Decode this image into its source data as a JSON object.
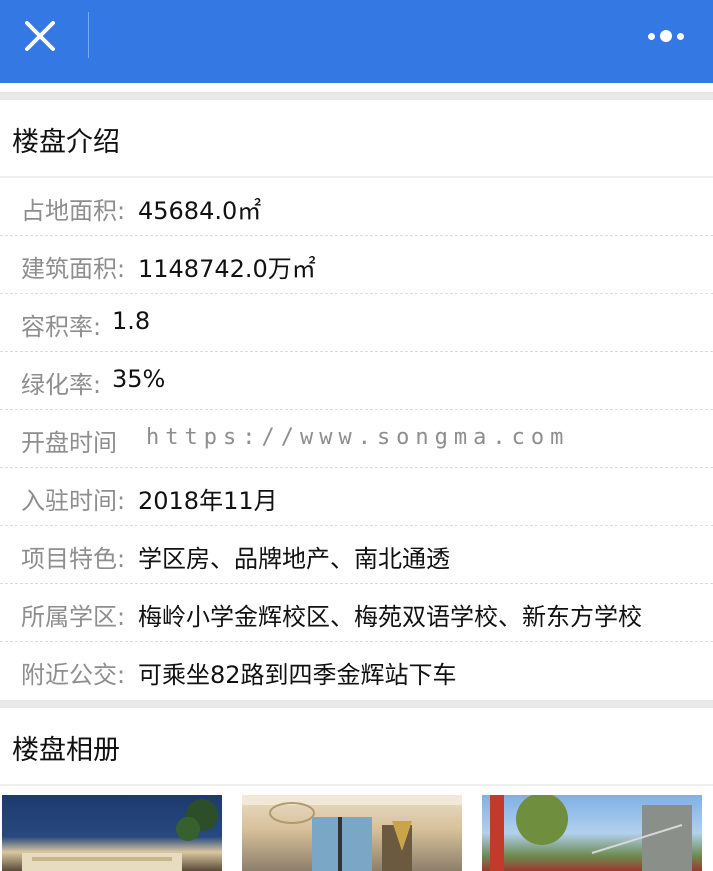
{
  "header": {
    "close_icon": "close-icon",
    "more_icon": "more-dots-icon",
    "bar_color": "#3478e4"
  },
  "intro": {
    "title": "楼盘介绍",
    "rows": [
      {
        "label": "占地面积:",
        "value": "45684.0㎡"
      },
      {
        "label": "建筑面积:",
        "value": "1148742.0万㎡"
      },
      {
        "label": "容积率:",
        "value": "1.8"
      },
      {
        "label": "绿化率:",
        "value": "35%"
      },
      {
        "label": "开盘时间",
        "value": "https://www.songma.com"
      },
      {
        "label": "入驻时间:",
        "value": "2018年11月"
      },
      {
        "label": "项目特色:",
        "value": "学区房、品牌地产、南北通透"
      },
      {
        "label": "所属学区:",
        "value": "梅岭小学金辉校区、梅苑双语学校、新东方学校"
      },
      {
        "label": "附近公交:",
        "value": "可乘坐82路到四季金辉站下车"
      }
    ]
  },
  "album": {
    "title": "楼盘相册"
  }
}
